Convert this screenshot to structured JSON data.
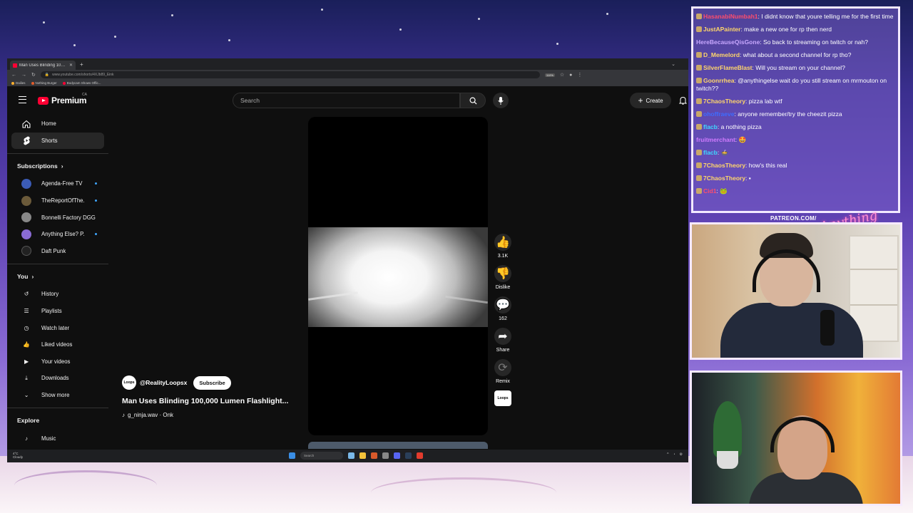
{
  "browser": {
    "tab_title": "Man Uses Blinding 100,000",
    "url": "www.youtube.com/shorts/4XJb89_Eink",
    "zoom": "110%",
    "bookmarks": [
      "Dailies",
      "Nothing Burger",
      "Bodycam Shows Offic..."
    ]
  },
  "youtube": {
    "logo_text": "Premium",
    "region": "CA",
    "search_placeholder": "Search",
    "create_label": "Create",
    "nav": [
      {
        "label": "Home",
        "icon": "home-icon"
      },
      {
        "label": "Shorts",
        "icon": "shorts-icon",
        "active": true
      }
    ],
    "subscriptions_title": "Subscriptions",
    "subscriptions": [
      {
        "label": "Agenda-Free TV",
        "color": "#3b5bb5",
        "live": true
      },
      {
        "label": "TheReportOfThe...",
        "color": "#6b5a3a",
        "live": true
      },
      {
        "label": "Bonnelli Factory DGG",
        "color": "#888888",
        "live": false
      },
      {
        "label": "Anything Else? P...",
        "color": "#8a6bd4",
        "live": true
      },
      {
        "label": "Daft Punk",
        "color": "#222222",
        "live": false
      }
    ],
    "you_title": "You",
    "you_items": [
      {
        "label": "History",
        "icon": "history-icon"
      },
      {
        "label": "Playlists",
        "icon": "playlists-icon"
      },
      {
        "label": "Watch later",
        "icon": "watch-later-icon"
      },
      {
        "label": "Liked videos",
        "icon": "liked-videos-icon"
      },
      {
        "label": "Your videos",
        "icon": "your-videos-icon"
      },
      {
        "label": "Downloads",
        "icon": "downloads-icon"
      },
      {
        "label": "Show more",
        "icon": "chevron-down-icon"
      }
    ],
    "explore_title": "Explore",
    "explore_items": [
      {
        "label": "Music",
        "icon": "music-icon"
      }
    ],
    "short": {
      "channel": "@RealityLoopsx",
      "channel_avatar_text": "Loops",
      "subscribe_label": "Subscribe",
      "title": "Man Uses Blinding 100,000 Lumen Flashlight...",
      "audio": "g_ninja.wav · Onk",
      "likes": "3.1K",
      "dislike_label": "Dislike",
      "comments": "162",
      "share_label": "Share",
      "remix_label": "Remix"
    }
  },
  "taskbar": {
    "weather_temp": "4°C",
    "weather_desc": "Cloudy",
    "search_label": "Search"
  },
  "chat": {
    "messages": [
      {
        "user": "HasanabiNumbah1",
        "color": "#ff4d6d",
        "text": "I didnt know that youre telling me for the first time",
        "badge": true
      },
      {
        "user": "JustAPainter",
        "color": "#ffd66b",
        "text": "make a new one for rp then nerd",
        "badge": true
      },
      {
        "user": "HereBecauseQisGone",
        "color": "#c8a8ff",
        "text": "So back to streaming on twitch or nah?",
        "badge": false
      },
      {
        "user": "D_Memelord",
        "color": "#ffd66b",
        "text": "what about a second channel for rp tho?",
        "badge": true
      },
      {
        "user": "SilverFlameBlast",
        "color": "#ffd66b",
        "text": "Will you stream on your channel?",
        "badge": true
      },
      {
        "user": "Goonrrhea",
        "color": "#ffd66b",
        "text": "@anythingelse wait do you still stream on mrmouton on twitch??",
        "badge": true
      },
      {
        "user": "7ChaosTheory",
        "color": "#ffd66b",
        "text": "pizza lab wtf",
        "badge": true
      },
      {
        "user": "ohoffraeve",
        "color": "#3e6cff",
        "text": "anyone remember/try the cheezit pizza",
        "badge": true
      },
      {
        "user": "flacb",
        "color": "#3ed9ff",
        "text": "a nothing pizza",
        "badge": true
      },
      {
        "user": "fruitmerchant",
        "color": "#d07bff",
        "text": "🤩",
        "badge": false
      },
      {
        "user": "flacb",
        "color": "#3ed9ff",
        "text": "🍲",
        "badge": true
      },
      {
        "user": "7ChaosTheory",
        "color": "#ffd66b",
        "text": "how's this real",
        "badge": true
      },
      {
        "user": "7ChaosTheory",
        "color": "#ffd66b",
        "text": "▪",
        "badge": true
      },
      {
        "user": "Cid1",
        "color": "#ff4d6d",
        "text": "🐸",
        "badge": true
      }
    ]
  },
  "overlay": {
    "patreon": "PATREON.COM/",
    "signature": "Anything Else?"
  }
}
